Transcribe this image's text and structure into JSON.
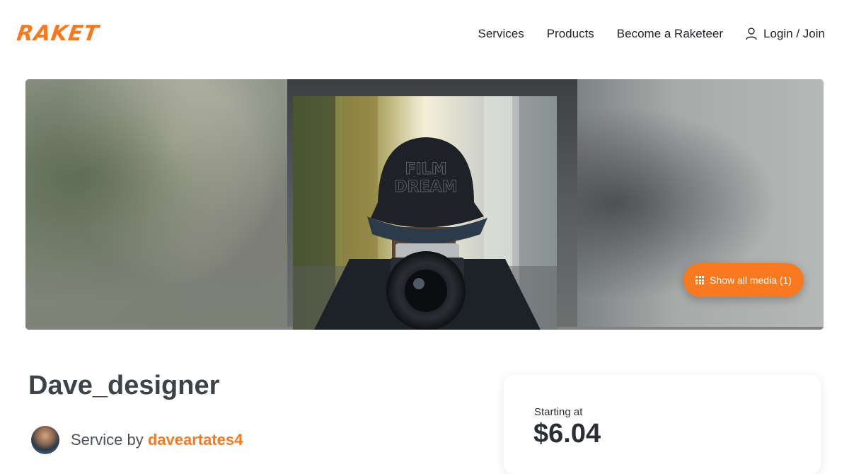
{
  "brand": {
    "logo_text": "RAKET",
    "accent_color": "#f97a1e"
  },
  "nav": {
    "items": [
      {
        "label": "Services"
      },
      {
        "label": "Products"
      },
      {
        "label": "Become a Raketeer"
      }
    ],
    "login_label": "Login / Join",
    "login_icon": "user-icon"
  },
  "hero": {
    "show_media_label": "Show all media (1)",
    "show_media_icon": "grid-icon"
  },
  "service": {
    "title": "Dave_designer",
    "byline_prefix": "Service by",
    "username": "daveartates4",
    "price_label": "Starting at",
    "price": "$6.04"
  }
}
